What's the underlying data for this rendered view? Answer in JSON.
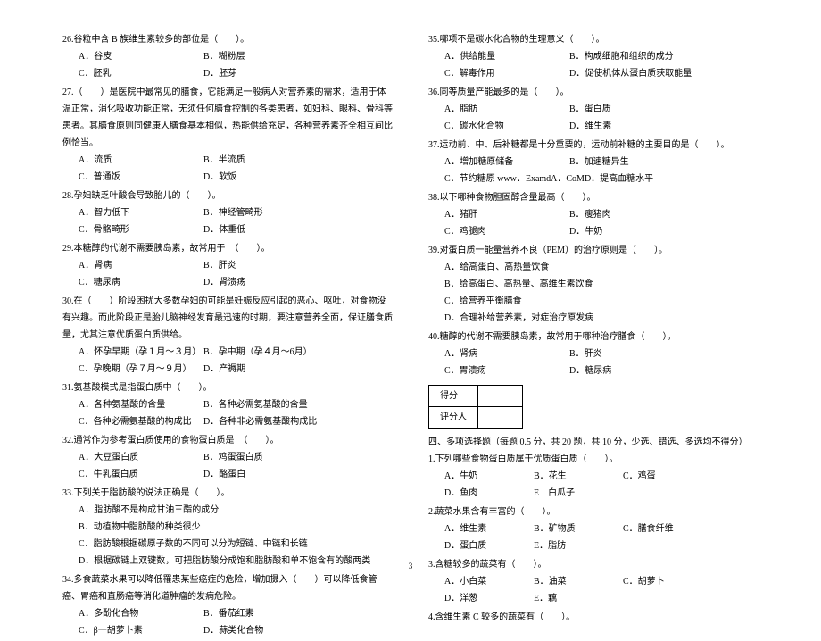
{
  "left": {
    "q26": {
      "text": "26.谷粒中含 B 族维生素较多的部位是（　　）。",
      "a": "A．谷皮",
      "b": "B．糊粉层",
      "c": "C．胚乳",
      "d": "D．胚芽"
    },
    "q27": {
      "text": "27.（　　）是医院中最常见的膳食，它能满足一般病人对营养素的需求，适用于体温正常，消化吸收功能正常，无须任何膳食控制的各类患者，如妇科、眼科、骨科等患者。其膳食原则同健康人膳食基本相似，热能供给充足，各种营养素齐全相互间比例恰当。",
      "a": "A．流质",
      "b": "B．半流质",
      "c": "C．普通饭",
      "d": "D．软饭"
    },
    "q28": {
      "text": "28.孕妇缺乏叶酸会导致胎儿的（　　）。",
      "a": "A．智力低下",
      "b": "B．神经管畸形",
      "c": "C．骨骼畸形",
      "d": "D．体重低"
    },
    "q29": {
      "text": "29.本糖醇的代谢不需要胰岛素，故常用于　（　　）。",
      "a": "A．肾病",
      "b": "B．肝炎",
      "c": "C．糖尿病",
      "d": "D．肾溃疡"
    },
    "q30": {
      "text": "30.在（　　）阶段困扰大多数孕妇的可能是妊娠反应引起的恶心、呕吐，对食物没有兴趣。而此阶段正是胎儿脑神经发育最迅速的时期，要注意营养全面，保证膳食质量，尤其注意优质蛋白质供给。",
      "a": "A．怀孕早期（孕１月～３月）",
      "b": "B．孕中期（孕４月～6月）",
      "c": "C．孕晚期（孕７月～９月）",
      "d": "D．产褥期"
    },
    "q31": {
      "text": "31.氨基酸模式是指蛋白质中（　　）。",
      "a": "A．各种氨基酸的含量",
      "b": "B．各种必需氨基酸的含量",
      "c": "C．各种必需氨基酸的构成比",
      "d": "D．各种非必需氨基酸构成比"
    },
    "q32": {
      "text": "32.通常作为参考蛋白质使用的食物蛋白质是　（　　）。",
      "a": "A．大豆蛋白质",
      "b": "B．鸡蛋蛋白质",
      "c": "C．牛乳蛋白质",
      "d": "D．酪蛋白"
    },
    "q33": {
      "text": "33.下列关于脂肪酸的说法正确是（　　）。",
      "a": "A．脂肪酸不是构成甘油三酯的成分",
      "b": "B．动植物中脂肪酸的种类很少",
      "c": "C．脂肪酸根据碳原子数的不同可以分为短链、中链和长链",
      "d": "D．根据碳链上双键数，可把脂肪酸分成饱和脂肪酸和单不饱含有的酸两类"
    },
    "q34": {
      "text": "34.多食蔬菜水果可以降低罹患某些癌症的危险，增加摄入（　　）可以降低食管癌、胃癌和直肠癌等消化道肿瘤的发病危险。",
      "a": "A．多酚化合物",
      "b": "B．番茄红素",
      "c": "C．β一胡萝卜素",
      "d": "D．蒜类化合物"
    }
  },
  "right": {
    "q35": {
      "text": "35.哪项不是碳水化合物的生理意义（　　）。",
      "a": "A．供给能量",
      "b": "B．构成细胞和组织的成分",
      "c": "C．解毒作用",
      "d": "D．促使机体从蛋白质获取能量"
    },
    "q36": {
      "text": "36.同等质量产能最多的是（　　）。",
      "a": "A．脂肪",
      "b": "B．蛋白质",
      "c": "C．碳水化合物",
      "d": "D．维生素"
    },
    "q37": {
      "text": "37.运动前、中、后补糖都是十分重要的，运动前补糖的主要目的是（　　）。",
      "a": "A．增加糖原储备",
      "b": "B．加速糖异生",
      "c": "C．节约糖原 www．ExamdA．CoM",
      "d": "D．提高血糖水平"
    },
    "q38": {
      "text": "38.以下哪种食物胆固醇含量最高（　　）。",
      "a": "A．猪肝",
      "b": "B．瘦猪肉",
      "c": "C．鸡腿肉",
      "d": "D．牛奶"
    },
    "q39": {
      "text": "39.对蛋白质一能量营养不良（PEM）的治疗原则是（　　）。",
      "a": "A．给高蛋白、高热量饮食",
      "b": "B．给高蛋白、高热量、高维生素饮食",
      "c": "C．给营养平衡膳食",
      "d": "D．合理补给营养素，对症治疗原发病"
    },
    "q40": {
      "text": "40.糖醇的代谢不需要胰岛素，故常用于哪种治疗膳食（　　）。",
      "a": "A．肾病",
      "b": "B．肝炎",
      "c": "C．胃溃疡",
      "d": "D．糖尿病"
    },
    "score": {
      "r1": "得分",
      "r2": "评分人"
    },
    "section4": "四、多项选择题（每题 0.5 分，共 20 题，共 10 分，少选、错选、多选均不得分）",
    "mq1": {
      "text": "1.下列哪些食物蛋白质属于优质蛋白质（　　）。",
      "a": "A．牛奶",
      "b": "B．花生",
      "c": "C．鸡蛋",
      "d": "D．鱼肉",
      "e": "E　白瓜子"
    },
    "mq2": {
      "text": "2.蔬菜水果含有丰富的（　　）。",
      "a": "A．维生素",
      "b": "B．矿物质",
      "c": "C．膳食纤维",
      "d": "D．蛋白质",
      "e": "E．脂肪"
    },
    "mq3": {
      "text": "3.含糖较多的蔬菜有（　　）。",
      "a": "A．小白菜",
      "b": "B．油菜",
      "c": "C．胡萝卜",
      "d": "D．洋葱",
      "e": "E．藕"
    },
    "mq4": {
      "text": "4.含维生素 C 较多的蔬菜有（　　）。"
    }
  },
  "pageNum": "3"
}
